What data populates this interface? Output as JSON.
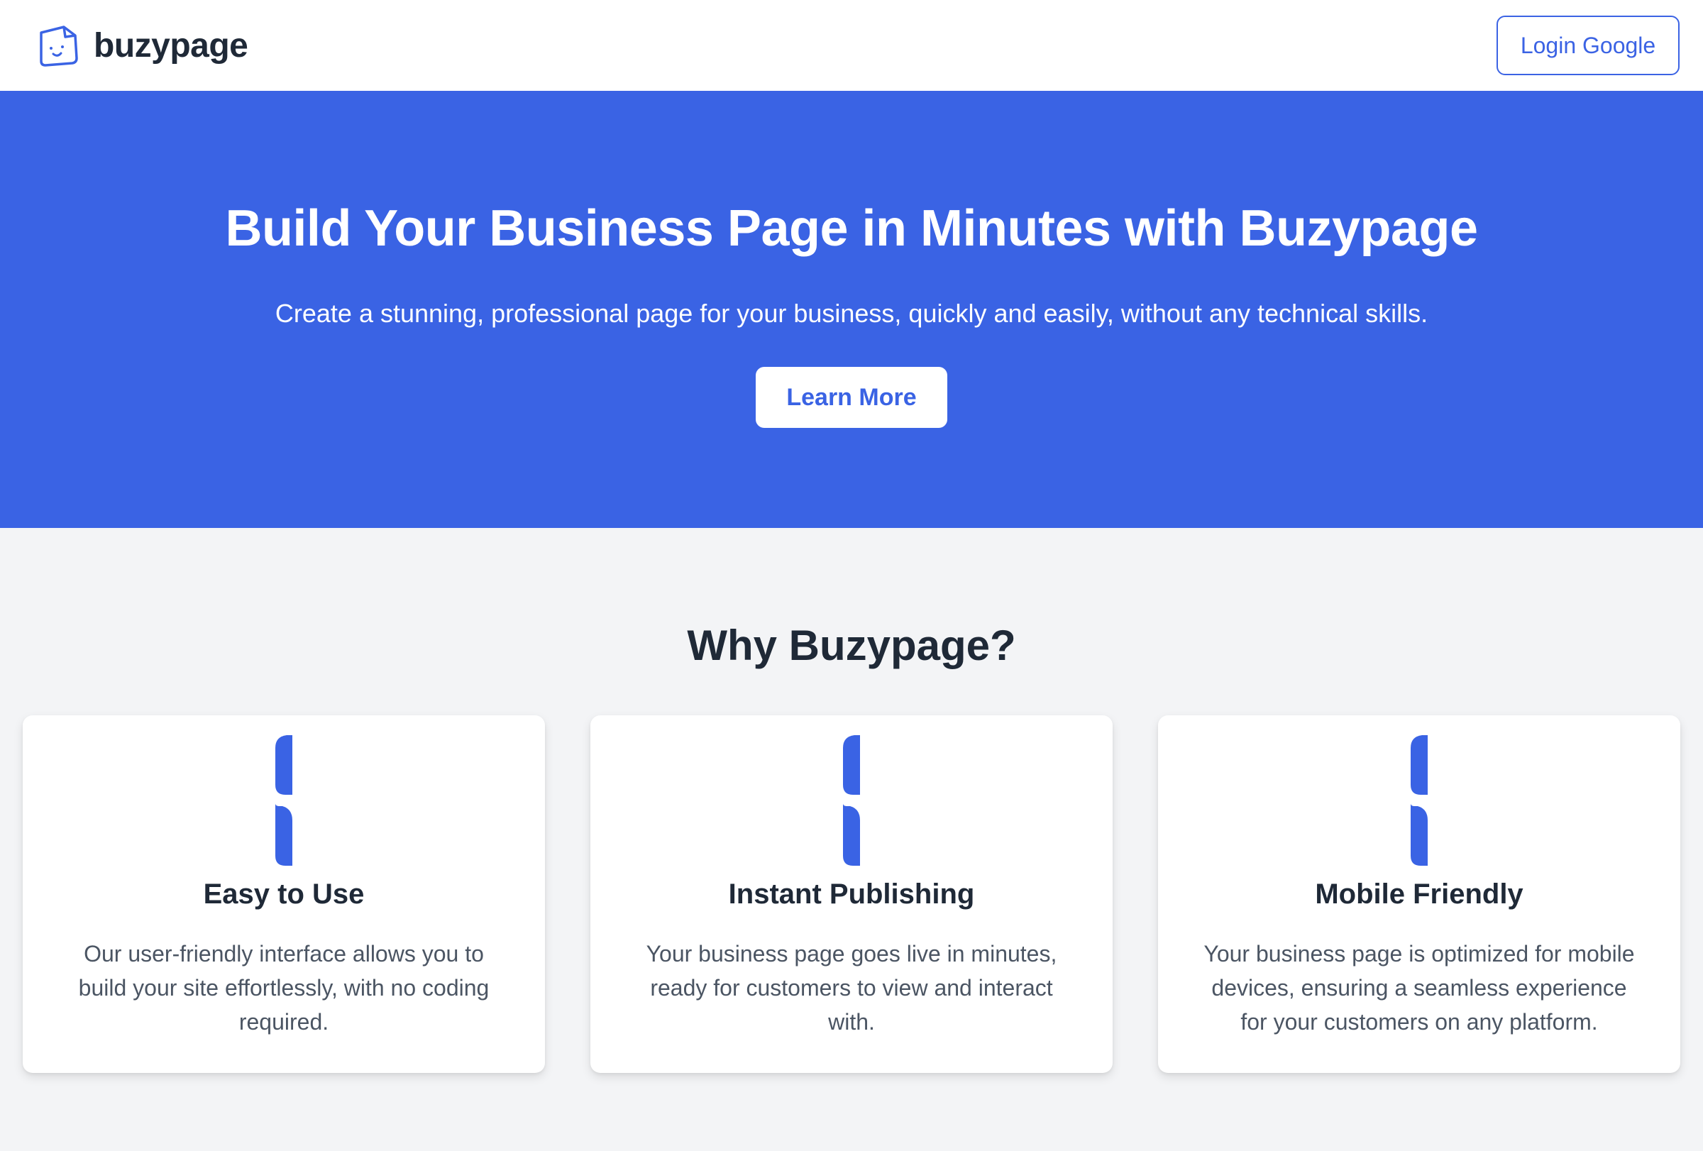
{
  "header": {
    "brand_name": "buzypage",
    "login_label": "Login Google",
    "logo_icon": "smiling-page-icon"
  },
  "hero": {
    "title": "Build Your Business Page in Minutes with Buzypage",
    "subtitle": "Create a stunning, professional page for your business, quickly and easily, without any technical skills.",
    "cta_label": "Learn More"
  },
  "features": {
    "title": "Why Buzypage?",
    "items": [
      {
        "icon": "feature-icon",
        "title": "Easy to Use",
        "text": "Our user-friendly interface allows you to build your site effortlessly, with no coding required."
      },
      {
        "icon": "feature-icon",
        "title": "Instant Publishing",
        "text": "Your business page goes live in minutes, ready for customers to view and interact with."
      },
      {
        "icon": "feature-icon",
        "title": "Mobile Friendly",
        "text": "Your business page is optimized for mobile devices, ensuring a seamless experience for your customers on any platform."
      }
    ]
  },
  "colors": {
    "accent": "#3a63e4",
    "page_background": "#f3f4f6",
    "heading_text": "#1f2937",
    "body_text": "#4b5563"
  }
}
